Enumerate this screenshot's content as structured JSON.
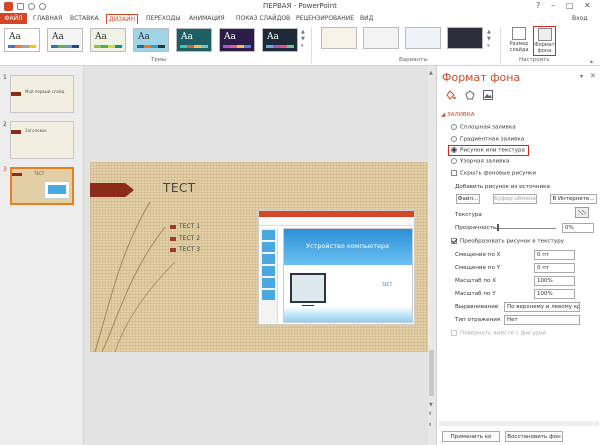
{
  "titlebar": {
    "title": "ПЕРВАЯ - PowerPoint",
    "window_controls": [
      "?",
      "–",
      "□",
      "✕"
    ]
  },
  "tabs": {
    "file": "ФАЙЛ",
    "items": [
      "ГЛАВНАЯ",
      "ВСТАВКА",
      "ДИЗАЙН",
      "ПЕРЕХОДЫ",
      "АНИМАЦИЯ",
      "ПОКАЗ СЛАЙДОВ",
      "РЕЦЕНЗИРОВАНИЕ",
      "ВИД"
    ],
    "active": "ДИЗАЙН",
    "user": "Вход"
  },
  "ribbon": {
    "themes_label": "Темы",
    "variants_label": "Варианты",
    "customize_label": "Настроить",
    "theme_text": "Aa",
    "slide_size": {
      "label": "Размер слайда",
      "icon": "slide-size-icon"
    },
    "format_bg": {
      "label": "Формат фона",
      "icon": "format-background-icon"
    }
  },
  "thumbnails": [
    {
      "num": "1",
      "title": "Мой первый слайд"
    },
    {
      "num": "2",
      "title": "Заголовок"
    },
    {
      "num": "3",
      "title": "ТЕСТ",
      "selected": true
    }
  ],
  "slide": {
    "title": "ТЕСТ",
    "bullets": [
      "ТЕСТ 1",
      "ТЕСТ 2",
      "ТЕСТ 3"
    ],
    "picture_title": "Устройство компьютера",
    "picture_small": "ТЕСТ"
  },
  "pane": {
    "title": "Формат фона",
    "close": "✕",
    "dropdown": "▾",
    "section": "ЗАЛИВКА",
    "fill_options": [
      "Сплошная заливка",
      "Градиентная заливка",
      "Рисунок или текстура",
      "Узорная заливка"
    ],
    "selected_fill": "Рисунок или текстура",
    "hide_bg": "Скрыть фоновые рисунки",
    "insert_from": "Добавить рисунок из источника",
    "btn_file": "Файл...",
    "btn_clipboard": "Буфер обмена",
    "btn_internet": "В Интернете...",
    "texture": "Текстура",
    "transparency": "Прозрачность",
    "transparency_value": "0%",
    "tile": "Преобразовать рисунок в текстуру",
    "offset_x": "Смещение по X",
    "offset_x_value": "0 пт",
    "offset_y": "Смещение по Y",
    "offset_y_value": "0 пт",
    "scale_x": "Масштаб по X",
    "scale_x_value": "100%",
    "scale_y": "Масштаб по Y",
    "scale_y_value": "100%",
    "alignment": "Выравнивание",
    "alignment_value": "По верхнему и левому краю",
    "mirror": "Тип отражения",
    "mirror_value": "Нет",
    "rotate": "Повернуть вместе с фигурой",
    "apply_all": "Применить ко всем",
    "reset": "Восстановить фон"
  },
  "colors": {
    "accent": "#d24726",
    "highlight": "#d9261c"
  }
}
